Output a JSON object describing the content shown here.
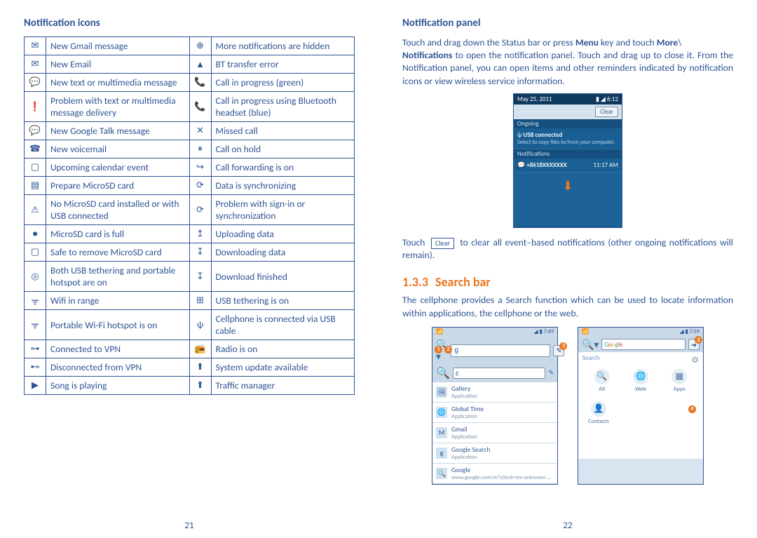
{
  "left": {
    "heading": "Notification icons",
    "page_num": "21",
    "rows": [
      {
        "i1": "✉",
        "t1": "New Gmail message",
        "i2": "⊕",
        "t2": "More notifications are hidden"
      },
      {
        "i1": "✉",
        "t1": "New Email",
        "i2": "▲",
        "t2": "BT transfer error"
      },
      {
        "i1": "💬",
        "t1": "New text or multimedia message",
        "i2": "📞",
        "t2": "Call in progress (green)"
      },
      {
        "i1": "❗",
        "t1": "Problem with text or multimedia message delivery",
        "i2": "📞",
        "t2": "Call in progress using Bluetooth headset (blue)"
      },
      {
        "i1": "💬",
        "t1": "New Google Talk message",
        "i2": "✕",
        "t2": "Missed call"
      },
      {
        "i1": "☎",
        "t1": "New voicemail",
        "i2": "⏸",
        "t2": "Call on hold"
      },
      {
        "i1": "▢",
        "t1": "Upcoming calendar event",
        "i2": "↪",
        "t2": "Call forwarding is on"
      },
      {
        "i1": "▤",
        "t1": "Prepare MicroSD card",
        "i2": "⟳",
        "t2": "Data is synchronizing"
      },
      {
        "i1": "⚠",
        "t1": "No MicroSD card installed or with USB connected",
        "i2": "⟳",
        "t2": "Problem with sign-in or synchronization"
      },
      {
        "i1": "●",
        "t1": "MicroSD card is full",
        "i2": "↥",
        "t2": "Uploading data"
      },
      {
        "i1": "▢",
        "t1": "Safe to remove MicroSD card",
        "i2": "↧",
        "t2": "Downloading data"
      },
      {
        "i1": "◎",
        "t1": "Both USB tethering and portable hotspot are on",
        "i2": "↧",
        "t2": "Download finished"
      },
      {
        "i1": "ᯤ",
        "t1": "Wifi in range",
        "i2": "⊞",
        "t2": "USB tethering is on"
      },
      {
        "i1": "ᯤ",
        "t1": "Portable Wi-Fi hotspot is on",
        "i2": "ψ",
        "t2": "Cellphone is connected via USB cable"
      },
      {
        "i1": "⊶",
        "t1": "Connected to VPN",
        "i2": "📻",
        "t2": "Radio is on"
      },
      {
        "i1": "⊷",
        "t1": "Disconnected from VPN",
        "i2": "⬆",
        "t2": "System update available"
      },
      {
        "i1": "▶",
        "t1": "Song is playing",
        "i2": "⬆",
        "t2": "Traffic manager"
      }
    ]
  },
  "right": {
    "heading": "Notification panel",
    "page_num": "22",
    "para1_a": "Touch and drag down the Status bar or press ",
    "para1_b": "Menu",
    "para1_c": " key and touch ",
    "para1_d": "More",
    "para1_e": "\\",
    "para1_f": "Notifications",
    "para1_g": " to open the notification panel. Touch and drag up to close it. From the Notification panel, you can open items and other reminders indicated by notification icons or view wireless service information.",
    "notif_shot": {
      "date": "May 25, 2011",
      "time": "6:12",
      "clear": "Clear",
      "ongoing_label": "Ongoing",
      "usb_title": "USB connected",
      "usb_sub": "Select to copy files to/from your computer.",
      "notifications_label": "Notifications",
      "msg_title": "+8618XXXXXXX",
      "msg_time": "11:17 AM"
    },
    "clear_btn": "Clear",
    "para2_a": "Touch ",
    "para2_b": " to clear all event–based notifications (other ongoing notifications will remain).",
    "section_num": "1.3.3",
    "section_title": "Search bar",
    "para3": "The cellphone provides a Search function which can be used to locate information within applications, the cellphone or the web.",
    "shot1": {
      "time": "7:49",
      "input": "g",
      "items": [
        {
          "ico": "🖼",
          "t": "Gallery",
          "s": "Application"
        },
        {
          "ico": "🌐",
          "t": "Global Time",
          "s": "Application"
        },
        {
          "ico": "M",
          "t": "Gmail",
          "s": "Application"
        },
        {
          "ico": "g",
          "t": "Google Search",
          "s": "Application"
        },
        {
          "ico": "🔍",
          "t": "Google",
          "s": "www.google.com/m?client=ms-unknown-..."
        }
      ],
      "markers": {
        "m1": "1",
        "m2": "2",
        "m3": "3"
      }
    },
    "shot2": {
      "time": "7:59",
      "google": "Google",
      "search_label": "Search",
      "cats": [
        {
          "ico": "🔍",
          "label": "All"
        },
        {
          "ico": "🌐",
          "label": "Web"
        },
        {
          "ico": "▦",
          "label": "Apps"
        }
      ],
      "contacts_ico": "👤",
      "contacts_label": "Contacts",
      "m3": "3",
      "m4": "4"
    }
  }
}
